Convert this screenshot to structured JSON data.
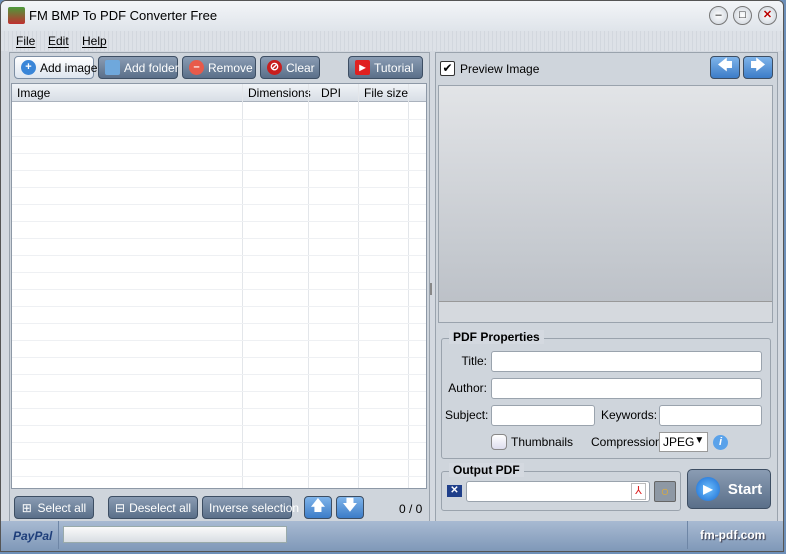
{
  "window": {
    "title": "FM BMP To PDF Converter Free"
  },
  "menu": [
    "File",
    "Edit",
    "Help"
  ],
  "toolbar": {
    "add_image": "Add image",
    "add_folder": "Add folder",
    "remove": "Remove",
    "clear": "Clear",
    "tutorial": "Tutorial"
  },
  "table": {
    "columns": [
      "Image",
      "Dimensions",
      "DPI",
      "File size"
    ],
    "rows": []
  },
  "bottom": {
    "select_all": "Select all",
    "deselect_all": "Deselect all",
    "inverse": "Inverse selection",
    "count": "0 / 0"
  },
  "preview": {
    "label": "Preview Image",
    "checked": true
  },
  "pdf_properties": {
    "legend": "PDF Properties",
    "title_label": "Title:",
    "author_label": "Author:",
    "subject_label": "Subject:",
    "keywords_label": "Keywords:",
    "title": "",
    "author": "",
    "subject": "",
    "keywords": "",
    "thumbnails_label": "Thumbnails",
    "thumbnails_checked": false,
    "compression_label": "Compression:",
    "compression": "JPEG"
  },
  "output": {
    "legend": "Output PDF",
    "path": ""
  },
  "start": "Start",
  "status": {
    "paypal": "PayPal",
    "site": "fm-pdf.com"
  }
}
